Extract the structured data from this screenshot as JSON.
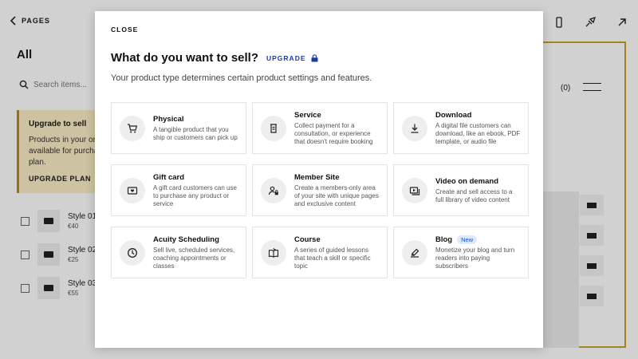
{
  "background": {
    "back_label": "PAGES",
    "section_title": "All",
    "search_placeholder": "Search items...",
    "upgrade_box": {
      "title": "Upgrade to sell",
      "text": "Products in your onli... available for purchas... plan.",
      "button": "UPGRADE PLAN"
    },
    "items": [
      {
        "name": "Style 01",
        "price": "€40"
      },
      {
        "name": "Style 02",
        "price": "€25"
      },
      {
        "name": "Style 03",
        "price": "€55"
      }
    ],
    "cart_count": "(0)"
  },
  "modal": {
    "close_label": "CLOSE",
    "title": "What do you want to sell?",
    "upgrade_label": "UPGRADE",
    "subtitle": "Your product type determines certain product settings and features.",
    "options": [
      {
        "name": "Physical",
        "desc": "A tangible product that you ship or customers can pick up",
        "icon": "cart-icon"
      },
      {
        "name": "Service",
        "desc": "Collect payment for a consultation, or experience that doesn't require booking",
        "icon": "service-icon"
      },
      {
        "name": "Download",
        "desc": "A digital file customers can download, like an ebook, PDF template, or audio file",
        "icon": "download-icon"
      },
      {
        "name": "Gift card",
        "desc": "A gift card customers can use to purchase any product or service",
        "icon": "gift-card-icon"
      },
      {
        "name": "Member Site",
        "desc": "Create a members-only area of your site with unique pages and exclusive content",
        "icon": "member-icon"
      },
      {
        "name": "Video on demand",
        "desc": "Create and sell access to a full library of video content",
        "icon": "video-icon"
      },
      {
        "name": "Acuity Scheduling",
        "desc": "Sell live, scheduled services, coaching appointments or classes",
        "icon": "clock-icon"
      },
      {
        "name": "Course",
        "desc": "A series of guided lessons that teach a skill or specific topic",
        "icon": "book-icon"
      },
      {
        "name": "Blog",
        "desc": "Monetize your blog and turn readers into paying subscribers",
        "icon": "blog-icon",
        "badge": "New"
      }
    ]
  },
  "colors": {
    "accent": "#1d3a9c",
    "badge_bg": "#dde9ff",
    "badge_text": "#1a4fd6",
    "upgrade_bg": "#fbeec6"
  }
}
